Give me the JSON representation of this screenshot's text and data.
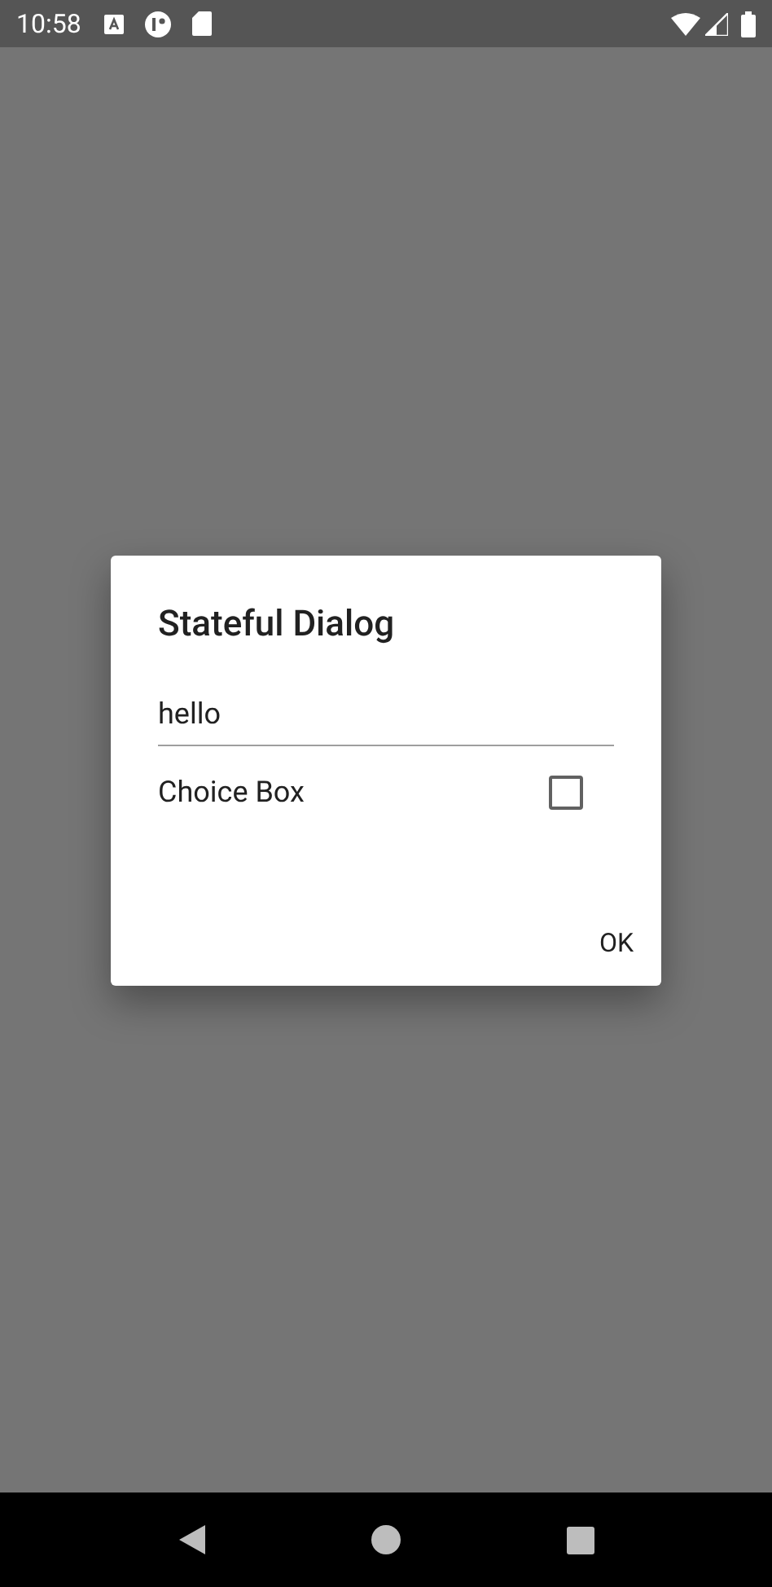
{
  "status_bar": {
    "time": "10:58"
  },
  "dialog": {
    "title": "Stateful Dialog",
    "field": {
      "value": "hello"
    },
    "choice": {
      "label": "Choice Box",
      "checked": false
    },
    "buttons": [
      "OK"
    ]
  }
}
